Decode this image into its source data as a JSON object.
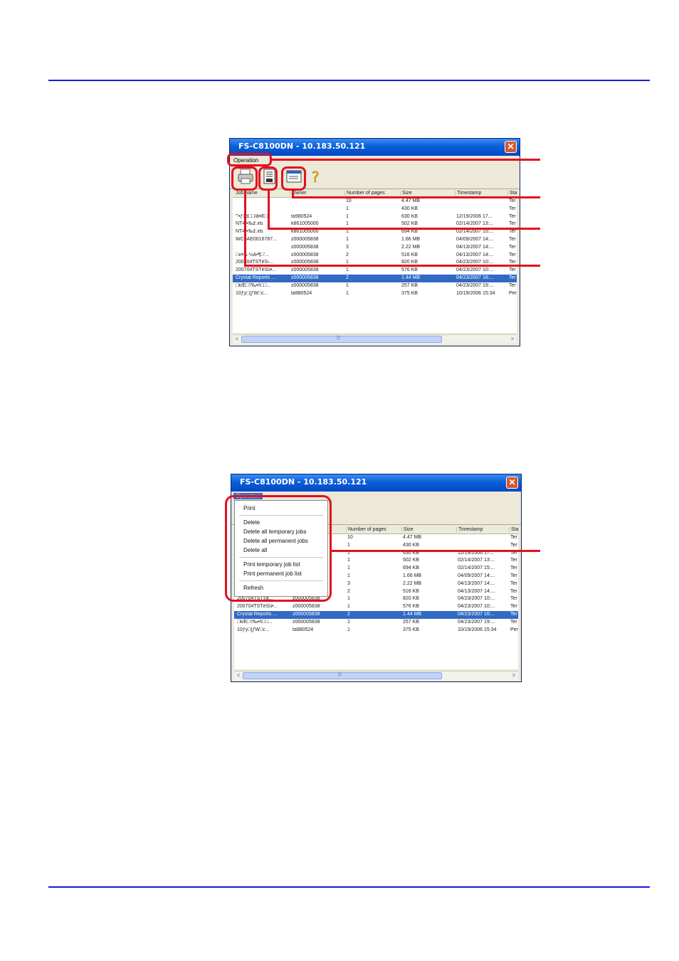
{
  "window": {
    "title": "FS-C8100DN - 10.183.50.121",
    "menu": "Operation",
    "close_glyph": "✕"
  },
  "toolbar_icons": [
    "print-icon",
    "job-list-icon",
    "properties-icon",
    "help-icon"
  ],
  "columns": [
    "Job name",
    "Owner",
    "Number of pages",
    "Size",
    "Timestamp",
    "Sta"
  ],
  "columns_bottom": [
    "",
    "",
    "Number of pages",
    "Size",
    "Timestamp",
    "Sta"
  ],
  "rows_top": [
    [
      "",
      "",
      "10",
      "4.47 MB",
      "",
      "Ter"
    ],
    [
      "",
      "",
      "1",
      "430 KB",
      "",
      "Ter"
    ],
    [
      "\"'•ƒ‡d□□/ã¤Ë□'",
      "ta980524",
      "1",
      "630 KB",
      "12/19/2006 17...",
      "Ter"
    ],
    [
      "NT4.•‰ž.xls",
      "k861005000",
      "1",
      "502 KB",
      "02/14/2007 13:...",
      "Ter"
    ],
    [
      "NT4.•‰ž.xls",
      "k861005000",
      "1",
      "694 KB",
      "02/14/2007 15:...",
      "Ter"
    ],
    [
      "WC0AE0016787...",
      "z000005838",
      "1",
      "1.66 MB",
      "04/09/2007 14:...",
      "Ter"
    ],
    [
      "",
      "z000005838",
      "3",
      "2.22 MB",
      "04/13/2007 14:...",
      "Ter"
    ],
    [
      "□v¤Ã·½Ä•¶□'...",
      "z000005838",
      "2",
      "516 KB",
      "04/13/2007 14:...",
      "Ter"
    ],
    [
      "200704TSTèŠ‹...",
      "z000005838",
      "1",
      "820 KB",
      "04/23/2007 10:...",
      "Ter"
    ],
    [
      "200704TSTèŠü•...",
      "z000005838",
      "1",
      "576 KB",
      "04/23/2007 10:...",
      "Ter"
    ],
    [
      "Crystal Reports ...",
      "z000005838",
      "2",
      "1.44 MB",
      "04/23/2007 16:...",
      "Ter"
    ],
    [
      "□k/E□'/‰•ñ□□...",
      "z000005838",
      "1",
      "257 KB",
      "04/23/2007 19:...",
      "Ter"
    ],
    [
      "10ƒy□[ƒW□c...",
      "ta980524",
      "1",
      "375 KB",
      "10/19/2006 15:34",
      "Per"
    ]
  ],
  "rows_bottom": [
    [
      "",
      "",
      "10",
      "4.47 MB",
      "",
      "Ter"
    ],
    [
      "",
      "",
      "1",
      "430 KB",
      "",
      "Ter"
    ],
    [
      "",
      "",
      "1",
      "630 KB",
      "12/19/2006 17...",
      "Ter"
    ],
    [
      "",
      "",
      "1",
      "502 KB",
      "02/14/2007 13:...",
      "Ter"
    ],
    [
      "",
      "",
      "1",
      "694 KB",
      "02/14/2007 15:...",
      "Ter"
    ],
    [
      "",
      "",
      "1",
      "1.66 MB",
      "04/09/2007 14:...",
      "Ter"
    ],
    [
      "",
      "",
      "3",
      "2.22 MB",
      "04/13/2007 14:...",
      "Ter"
    ],
    [
      "",
      "",
      "2",
      "516 KB",
      "04/13/2007 14:...",
      "Ter"
    ],
    [
      "200704TST‡å...",
      "z000005838",
      "1",
      "820 KB",
      "04/23/2007 10:...",
      "Ter"
    ],
    [
      "200704TSTèŠü•...",
      "z000005838",
      "1",
      "576 KB",
      "04/23/2007 10:...",
      "Ter"
    ],
    [
      "Crystal Reports ...",
      "z000005838",
      "2",
      "1.44 MB",
      "04/23/2007 16:...",
      "Ter"
    ],
    [
      "□k/E□'/‰•ñ□□...",
      "z000005838",
      "1",
      "257 KB",
      "04/23/2007 19:...",
      "Ter"
    ],
    [
      "10ƒy□[ƒW□c...",
      "ta980524",
      "1",
      "375 KB",
      "10/19/2006 15:34",
      "Per"
    ]
  ],
  "menu_items": [
    "Print",
    "Delete",
    "Delete all temporary jobs",
    "Delete all permanent jobs",
    "Delete all",
    "Print temporary job list",
    "Print permanent job list",
    "Refresh"
  ],
  "scroll_left": "<",
  "scroll_right": ">",
  "scroll_grip": "|||",
  "colors": {
    "rule": "#1a1adb",
    "callout": "#e3101e",
    "selection": "#316ac5",
    "titlebar": "#0a5fd8"
  }
}
